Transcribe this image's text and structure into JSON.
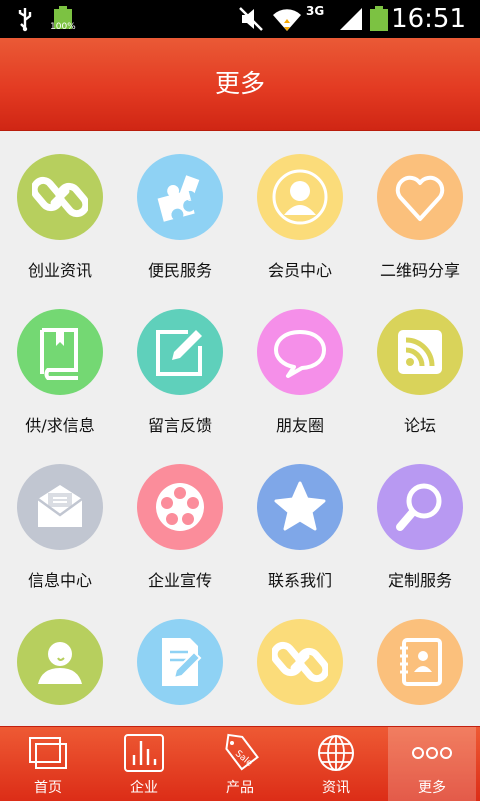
{
  "status_bar": {
    "battery_percent": "100%",
    "network": "3G",
    "time": "16:51"
  },
  "header": {
    "title": "更多"
  },
  "grid": {
    "items": [
      {
        "label": "创业资讯",
        "icon": "link-icon",
        "color": "#b7cf5e"
      },
      {
        "label": "便民服务",
        "icon": "puzzle-icon",
        "color": "#8fd2f4"
      },
      {
        "label": "会员中心",
        "icon": "member-icon",
        "color": "#fbdc7a"
      },
      {
        "label": "二维码分享",
        "icon": "heart-icon",
        "color": "#fbc07c"
      },
      {
        "label": "供/求信息",
        "icon": "book-icon",
        "color": "#74d873"
      },
      {
        "label": "留言反馈",
        "icon": "edit-icon",
        "color": "#5fd0bb"
      },
      {
        "label": "朋友圈",
        "icon": "chat-bubble-icon",
        "color": "#f58fe9"
      },
      {
        "label": "论坛",
        "icon": "rss-icon",
        "color": "#d9d35a"
      },
      {
        "label": "信息中心",
        "icon": "mail-icon",
        "color": "#c1c6d1"
      },
      {
        "label": "企业宣传",
        "icon": "film-reel-icon",
        "color": "#fb8d9b"
      },
      {
        "label": "联系我们",
        "icon": "star-icon",
        "color": "#7fa7e8"
      },
      {
        "label": "定制服务",
        "icon": "magnifier-icon",
        "color": "#b899f2"
      },
      {
        "label": "",
        "icon": "user-icon",
        "color": "#b7cf5e"
      },
      {
        "label": "",
        "icon": "document-pencil-icon",
        "color": "#8fd2f4"
      },
      {
        "label": "",
        "icon": "link-icon",
        "color": "#fbdc7a"
      },
      {
        "label": "",
        "icon": "contacts-icon",
        "color": "#fbc07c"
      }
    ]
  },
  "bottom_nav": {
    "items": [
      {
        "label": "首页",
        "icon": "windows-icon"
      },
      {
        "label": "企业",
        "icon": "bar-chart-icon"
      },
      {
        "label": "产品",
        "icon": "sale-tag-icon"
      },
      {
        "label": "资讯",
        "icon": "globe-icon"
      },
      {
        "label": "更多",
        "icon": "more-dots-icon"
      }
    ],
    "active_index": 4
  }
}
